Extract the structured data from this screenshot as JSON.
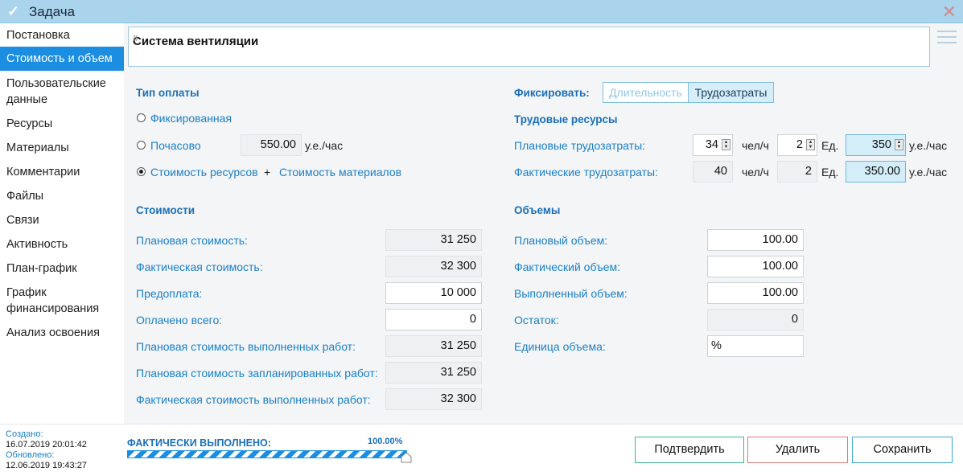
{
  "window": {
    "title": "Задача",
    "check_icon": "check-icon",
    "close_icon": "close-icon"
  },
  "sidebar": {
    "items": [
      {
        "label": "Постановка"
      },
      {
        "label": "Стоимость и объем",
        "active": true
      },
      {
        "label": "Пользовательские\nданные"
      },
      {
        "label": "Ресурсы"
      },
      {
        "label": "Материалы"
      },
      {
        "label": "Комментарии"
      },
      {
        "label": "Файлы"
      },
      {
        "label": "Связи"
      },
      {
        "label": "Активность"
      },
      {
        "label": "План-график"
      },
      {
        "label": "График\nфинансирования"
      },
      {
        "label": "Анализ освоения"
      }
    ]
  },
  "task_title": "Система вентиляции",
  "payment": {
    "header": "Тип оплаты",
    "fixed": "Фиксированная",
    "hourly": "Почасово",
    "hourly_value": "550.00",
    "hourly_unit": "у.е./час",
    "resources_cost": "Стоимость ресурсов",
    "plus": "+",
    "materials_cost": "Стоимость материалов",
    "selected": "resources_cost"
  },
  "fix": {
    "label": "Фиксировать:",
    "options": [
      "Длительность",
      "Трудозатраты"
    ],
    "selected": "Трудозатраты"
  },
  "labor": {
    "header": "Трудовые ресурсы",
    "planned_label": "Плановые трудозатраты:",
    "planned_value": "34",
    "unit_hours": "чел/ч",
    "planned_units": "2",
    "unit_label": "Ед.",
    "planned_rate": "350",
    "rate_unit": "у.е./час",
    "actual_label": "Фактические трудозатраты:",
    "actual_value": "40",
    "actual_units": "2",
    "actual_rate": "350.00"
  },
  "costs": {
    "header": "Стоимости",
    "rows": [
      {
        "label": "Плановая стоимость:",
        "value": "31 250",
        "readonly": true
      },
      {
        "label": "Фактическая стоимость:",
        "value": "32 300",
        "readonly": true
      },
      {
        "label": "Предоплата:",
        "value": "10 000",
        "readonly": false
      },
      {
        "label": "Оплачено всего:",
        "value": "0",
        "readonly": false
      },
      {
        "label": "Плановая стоимость выполненных работ:",
        "value": "31 250",
        "readonly": true
      },
      {
        "label": "Плановая стоимость запланированных работ:",
        "value": "31 250",
        "readonly": true
      },
      {
        "label": "Фактическая стоимость выполненных работ:",
        "value": "32 300",
        "readonly": true
      }
    ]
  },
  "volumes": {
    "header": "Объемы",
    "rows": [
      {
        "label": "Плановый объем:",
        "value": "100.00",
        "readonly": false
      },
      {
        "label": "Фактический объем:",
        "value": "100.00",
        "readonly": false
      },
      {
        "label": "Выполненный объем:",
        "value": "100.00",
        "readonly": false
      },
      {
        "label": "Остаток:",
        "value": "0",
        "readonly": true
      },
      {
        "label": "Единица объема:",
        "value": "%",
        "readonly": false
      }
    ]
  },
  "footer": {
    "created_label": "Создано:",
    "created": "16.07.2019 20:01:42",
    "updated_label": "Обновлено:",
    "updated": "12.06.2019 19:43:27",
    "progress_label": "ФАКТИЧЕСКИ ВЫПОЛНЕНО:",
    "progress_text": "100.00%",
    "progress": 1.0,
    "confirm": "Подтвердить",
    "delete": "Удалить",
    "save": "Сохранить"
  },
  "colors": {
    "accent": "#1b8ee2",
    "confirm_border": "#3cb98f",
    "delete_border": "#e07a7a",
    "save_border": "#3aa6d0"
  }
}
